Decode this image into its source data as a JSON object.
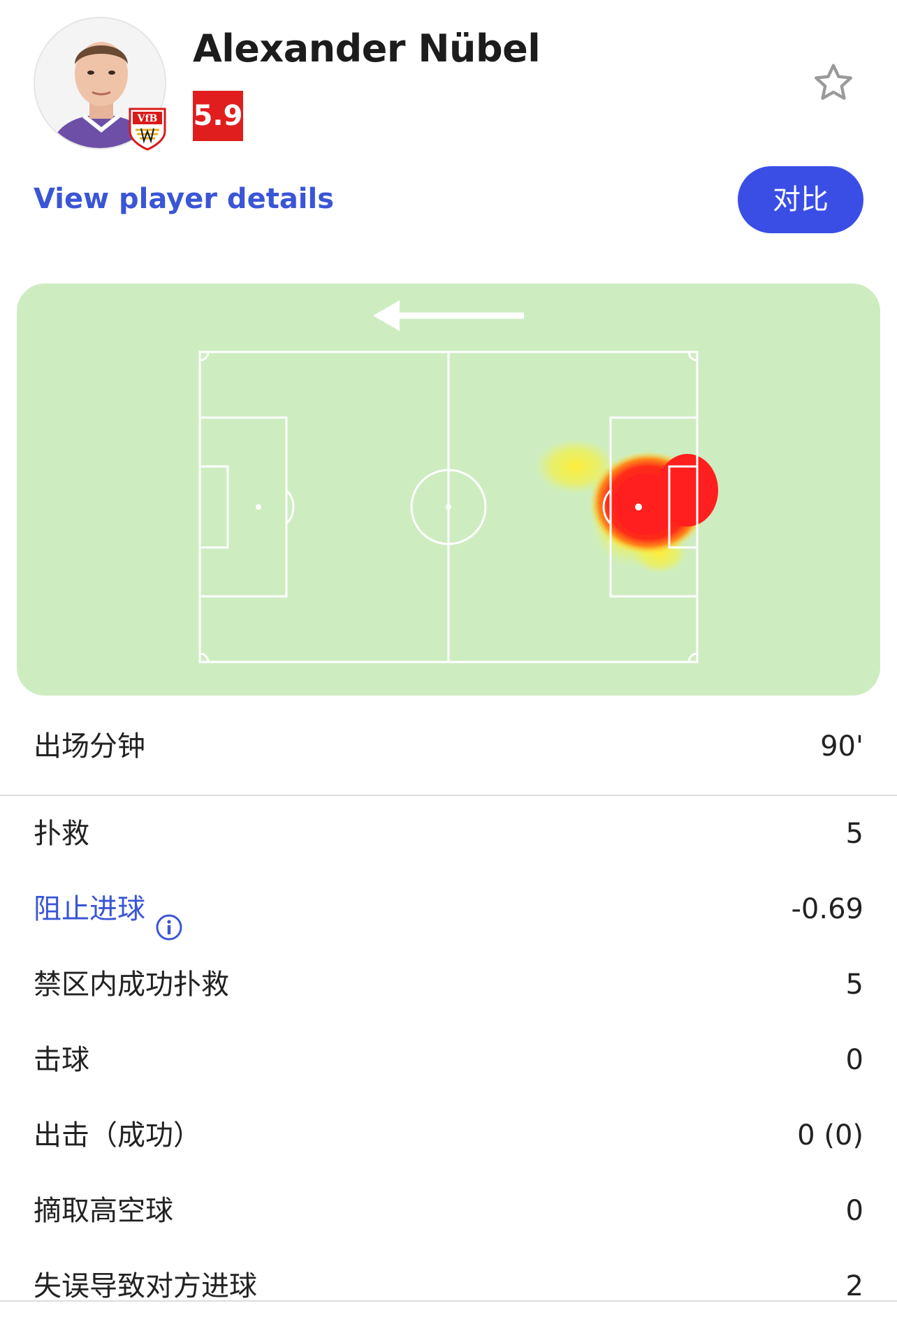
{
  "player": {
    "name": "Alexander Nübel",
    "rating": "5.9",
    "rating_color": "#e01e1e",
    "avatar_icon": "player-photo",
    "club_badge_icon": "vfb-stuttgart-crest",
    "club_badge_text": "VfB"
  },
  "actions": {
    "view_details_label": "View player details",
    "compare_label": "对比",
    "favorite_icon": "star-outline-icon"
  },
  "heatmap": {
    "attack_direction": "left",
    "pitch_color": "#cdedc1",
    "hot_color": "#ff1f1f",
    "warm_color": "#ffee33"
  },
  "stats": {
    "minutes": {
      "label": "出场分钟",
      "value": "90'"
    },
    "rows": [
      {
        "label": "扑救",
        "value": "5",
        "link": false
      },
      {
        "label": "阻止进球",
        "value": "-0.69",
        "link": true
      },
      {
        "label": "禁区内成功扑救",
        "value": "5",
        "link": false
      },
      {
        "label": "击球",
        "value": "0",
        "link": false
      },
      {
        "label": "出击（成功）",
        "value": "0 (0)",
        "link": false
      },
      {
        "label": "摘取高空球",
        "value": "0",
        "link": false
      },
      {
        "label": "失误导致对方进球",
        "value": "2",
        "link": false
      }
    ]
  },
  "colors": {
    "accent": "#3a4ee6",
    "link": "#3a55d6"
  }
}
